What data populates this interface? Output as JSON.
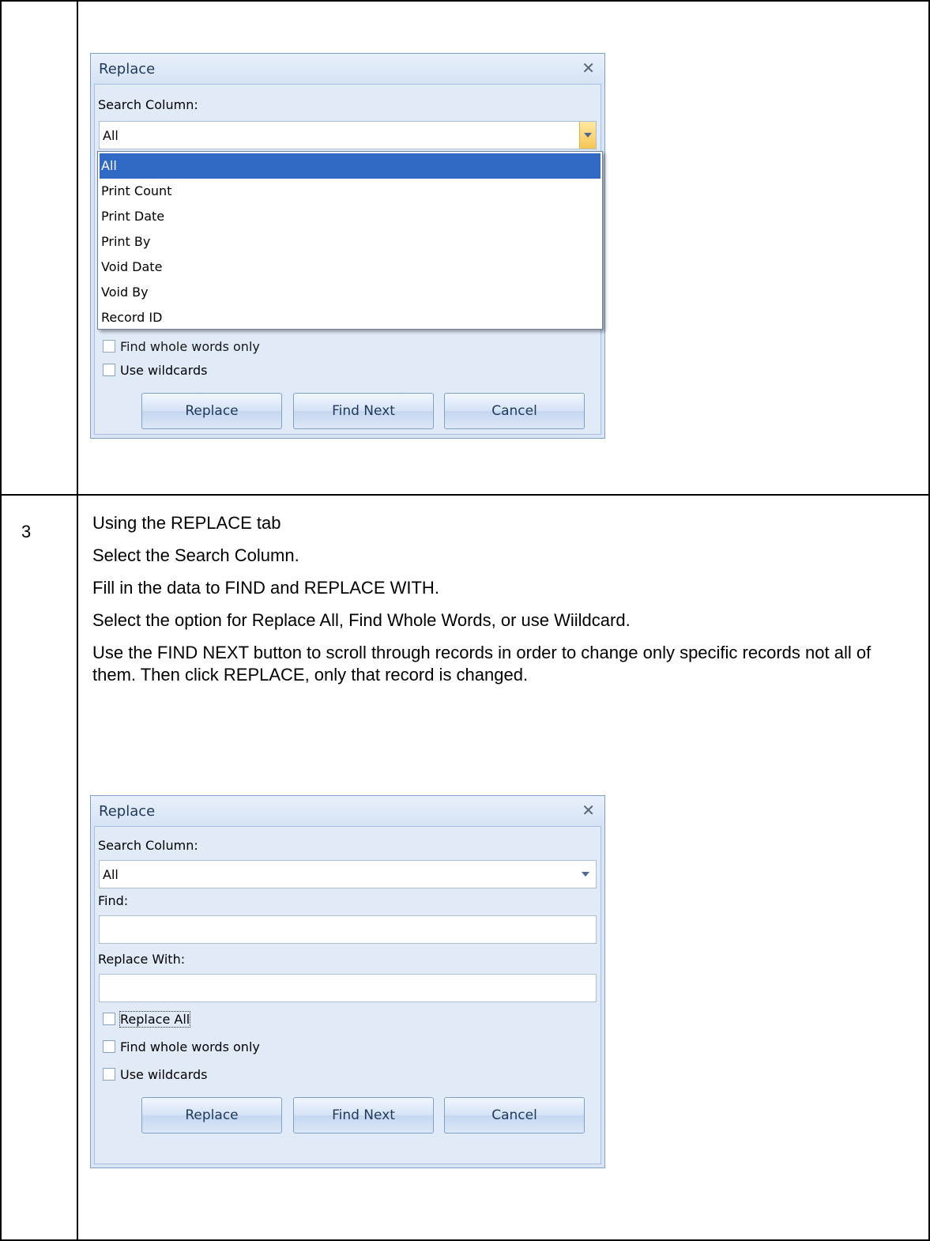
{
  "step": {
    "number": "3"
  },
  "instructions": [
    "Using the REPLACE tab",
    "Select the Search Column.",
    "Fill in the data to FIND and REPLACE WITH.",
    "Select the option for Replace All, Find Whole Words, or use Wiildcard.",
    "Use the FIND NEXT button to scroll through records in order to change only specific records not all of them. Then click REPLACE, only that record is changed."
  ],
  "dialog_top": {
    "title": "Replace",
    "search_column_label": "Search Column:",
    "search_column_value": "All",
    "dropdown_options": [
      "All",
      "Print Count",
      "Print Date",
      "Print By",
      "Void Date",
      "Void By",
      "Record ID"
    ],
    "dropdown_selected": "All",
    "partial_checkbox_label": "Find whole words only",
    "use_wildcards_label": "Use wildcards",
    "buttons": {
      "replace": "Replace",
      "find_next": "Find Next",
      "cancel": "Cancel"
    }
  },
  "dialog_bottom": {
    "title": "Replace",
    "search_column_label": "Search Column:",
    "search_column_value": "All",
    "find_label": "Find:",
    "find_value": "",
    "replace_with_label": "Replace With:",
    "replace_with_value": "",
    "replace_all_label": "Replace All",
    "find_whole_words_label": "Find whole words only",
    "use_wildcards_label": "Use wildcards",
    "buttons": {
      "replace": "Replace",
      "find_next": "Find Next",
      "cancel": "Cancel"
    }
  },
  "colors": {
    "dialog_bg": "#d9e5f5",
    "selected_item": "#316ac5",
    "title_text": "#1e395b"
  }
}
